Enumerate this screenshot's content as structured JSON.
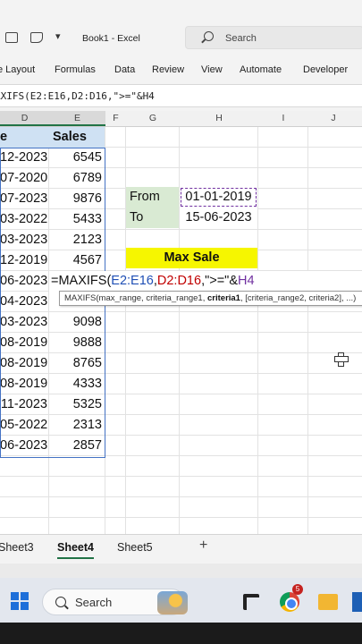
{
  "titlebar": {
    "title": "Book1  -  Excel",
    "search_label": "Search"
  },
  "ribbon": {
    "tabs": [
      "e Layout",
      "Formulas",
      "Data",
      "Review",
      "View",
      "Automate",
      "Developer"
    ]
  },
  "formula_bar": {
    "text": "AXIFS(E2:E16,D2:D16,\">=\"&H4"
  },
  "columns": [
    "D",
    "E",
    "F",
    "G",
    "H",
    "I",
    "J"
  ],
  "table": {
    "header_d": "e",
    "header_e": "Sales",
    "rows": [
      {
        "d": "12-2023",
        "e": "6545"
      },
      {
        "d": "07-2020",
        "e": "6789"
      },
      {
        "d": "07-2023",
        "e": "9876"
      },
      {
        "d": "03-2022",
        "e": "5433"
      },
      {
        "d": "03-2023",
        "e": "2123"
      },
      {
        "d": "12-2019",
        "e": "4567"
      },
      {
        "d": "06-2023",
        "e": ""
      },
      {
        "d": "04-2023",
        "e": ""
      },
      {
        "d": "03-2023",
        "e": "9098"
      },
      {
        "d": "08-2019",
        "e": "9888"
      },
      {
        "d": "08-2019",
        "e": "8765"
      },
      {
        "d": "08-2019",
        "e": "4333"
      },
      {
        "d": "11-2023",
        "e": "5325"
      },
      {
        "d": "05-2022",
        "e": "2313"
      },
      {
        "d": "06-2023",
        "e": "2857"
      }
    ]
  },
  "criteria": {
    "from_label": "From",
    "from_value": "01-01-2019",
    "to_label": "To",
    "to_value": "15-06-2023"
  },
  "max_sale": {
    "label": "Max Sale"
  },
  "editing": {
    "prefix": "=MAXIFS(",
    "range1": "E2:E16",
    "comma1": ",",
    "range2": "D2:D16",
    "middle": ",\">=\"&",
    "range3": "H4"
  },
  "tooltip": {
    "fn": "MAXIFS(",
    "args_before": "max_range, criteria_range1, ",
    "current_arg": "criteria1",
    "args_after": ", [criteria_range2, criteria2], ...)"
  },
  "sheets": {
    "tabs": [
      "Sheet3",
      "Sheet4",
      "Sheet5"
    ],
    "active": "Sheet4",
    "add_label": "+"
  },
  "taskbar": {
    "search_label": "Search",
    "badge": "5"
  },
  "colors": {
    "excel_green": "#217346",
    "header_blue": "#cfe1f3",
    "label_green": "#d9ead3",
    "highlight_yellow": "#f6f600"
  }
}
